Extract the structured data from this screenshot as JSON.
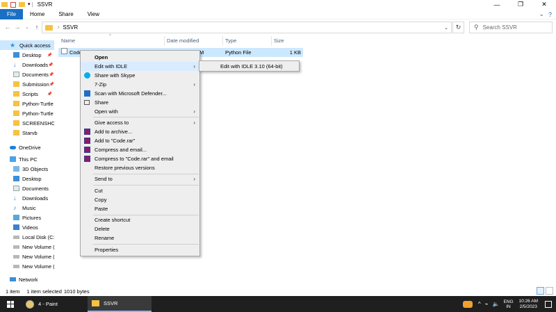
{
  "window": {
    "title": "SSVR",
    "controls": {
      "minimize": "—",
      "maximize": "❐",
      "close": "✕"
    }
  },
  "ribbon": {
    "tabs": [
      "File",
      "Home",
      "Share",
      "View"
    ],
    "expand_icon": "chevron-down",
    "help_icon": "?"
  },
  "address_bar": {
    "back": "←",
    "forward": "→",
    "recent": "⌄",
    "up": "↑",
    "path": [
      "SSVR"
    ],
    "dropdown": "⌄",
    "refresh": "↻"
  },
  "search": {
    "placeholder": "Search SSVR",
    "icon": "⚲"
  },
  "nav_pane": {
    "items": [
      {
        "label": "Quick access",
        "icon": "star-icon",
        "selected": true
      },
      {
        "label": "Desktop",
        "icon": "desktop-icon",
        "pinned": true
      },
      {
        "label": "Downloads",
        "icon": "downloads-icon",
        "pinned": true
      },
      {
        "label": "Documents",
        "icon": "documents-icon",
        "pinned": true
      },
      {
        "label": "Submission",
        "icon": "folder-icon",
        "pinned": true
      },
      {
        "label": "Scripts",
        "icon": "folder-icon",
        "pinned": true
      },
      {
        "label": "Python-Turtle",
        "icon": "folder-icon"
      },
      {
        "label": "Python-Turtle",
        "icon": "folder-icon"
      },
      {
        "label": "SCREENSHOTS",
        "icon": "folder-icon"
      },
      {
        "label": "Starvb",
        "icon": "folder-icon"
      },
      {
        "label": "OneDrive",
        "icon": "onedrive-icon"
      },
      {
        "label": "This PC",
        "icon": "pc-icon"
      },
      {
        "label": "3D Objects",
        "icon": "3d-objects-icon"
      },
      {
        "label": "Desktop",
        "icon": "desktop-icon"
      },
      {
        "label": "Documents",
        "icon": "documents-icon"
      },
      {
        "label": "Downloads",
        "icon": "downloads-icon"
      },
      {
        "label": "Music",
        "icon": "music-icon"
      },
      {
        "label": "Pictures",
        "icon": "pictures-icon"
      },
      {
        "label": "Videos",
        "icon": "videos-icon"
      },
      {
        "label": "Local Disk (C:)",
        "icon": "disk-icon"
      },
      {
        "label": "New Volume (",
        "icon": "disk-icon"
      },
      {
        "label": "New Volume (",
        "icon": "disk-icon"
      },
      {
        "label": "New Volume (",
        "icon": "disk-icon"
      },
      {
        "label": "Network",
        "icon": "network-icon"
      }
    ]
  },
  "columns": {
    "name": "Name",
    "date": "Date modified",
    "type": "Type",
    "size": "Size"
  },
  "file": {
    "name": "Code",
    "date_fragment": "M",
    "type": "Python File",
    "size": "1 KB"
  },
  "context_menu": {
    "open": "Open",
    "edit_idle": "Edit with IDLE",
    "skype": "Share with Skype",
    "zip": "7-Zip",
    "defender": "Scan with Microsoft Defender...",
    "share": "Share",
    "open_with": "Open with",
    "give_access": "Give access to",
    "add_archive": "Add to archive...",
    "add_rar": "Add to \"Code.rar\"",
    "compress_email": "Compress and email...",
    "compress_rar_email": "Compress to \"Code.rar\" and email",
    "restore": "Restore previous versions",
    "send_to": "Send to",
    "cut": "Cut",
    "copy": "Copy",
    "paste": "Paste",
    "create_shortcut": "Create shortcut",
    "delete": "Delete",
    "rename": "Rename",
    "properties": "Properties",
    "arrow": "›"
  },
  "submenu": {
    "item": "Edit with IDLE 3.10 (64-bit)"
  },
  "status": {
    "count": "1 item",
    "selected": "1 item selected",
    "size": "1010 bytes"
  },
  "taskbar": {
    "apps": [
      {
        "label": "4 - Paint"
      },
      {
        "label": "SSVR",
        "active": true
      }
    ],
    "tray": {
      "chevron": "^",
      "network": "⌁",
      "volume": "🔈",
      "lang_top": "ENG",
      "lang_bottom": "IN",
      "time": "10:26 AM",
      "date": "2/5/2023"
    }
  }
}
